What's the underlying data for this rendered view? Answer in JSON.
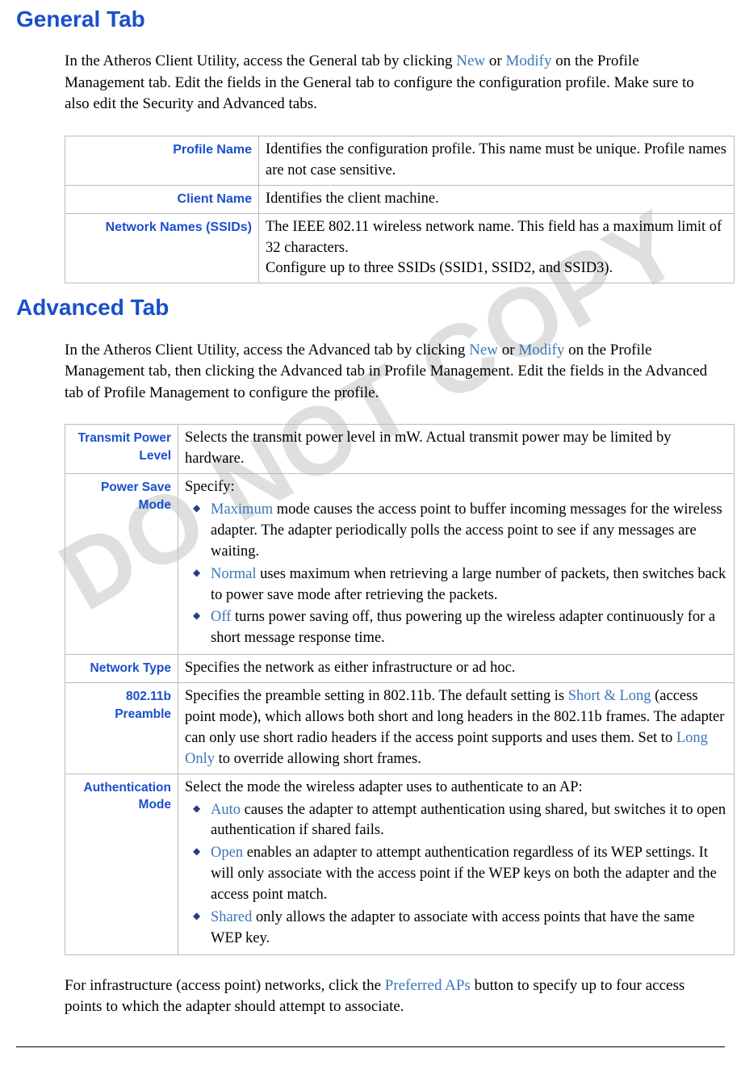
{
  "watermark": "DO NOT COPY",
  "general": {
    "heading": "General Tab",
    "intro_pre": "In the Atheros Client Utility, access the General tab by clicking ",
    "intro_new": "New",
    "intro_or": " or ",
    "intro_modify": "Modify",
    "intro_post": " on the Profile Management tab. Edit the fields in the General tab to configure the configuration profile. Make sure to also edit the Security and Advanced tabs.",
    "rows": {
      "profile_name": {
        "label": "Profile Name",
        "desc": "Identifies the configuration profile. This name must be unique. Profile names are not case sensitive."
      },
      "client_name": {
        "label": "Client Name",
        "desc": "Identifies the client machine."
      },
      "ssids": {
        "label": "Network Names (SSIDs)",
        "desc1": "The IEEE 802.11 wireless network name. This field has a maximum limit of 32 characters.",
        "desc2": "Configure up to three SSIDs (SSID1, SSID2, and SSID3)."
      }
    }
  },
  "advanced": {
    "heading": "Advanced Tab",
    "intro_pre": "In the Atheros Client Utility, access the Advanced tab by clicking ",
    "intro_new": "New",
    "intro_or": " or ",
    "intro_modify": "Modify",
    "intro_post": " on the Profile Management tab, then clicking the Advanced tab in Profile Management.  Edit the fields in the Advanced tab of Profile Management to configure the profile.",
    "rows": {
      "transmit": {
        "label": "Transmit Power Level",
        "desc": "Selects the transmit power level in mW. Actual transmit power may be limited by hardware."
      },
      "powersave": {
        "label": "Power Save Mode",
        "intro": "Specify:",
        "opts": {
          "max_name": "Maximum",
          "max_desc": " mode causes the  access point to buffer incoming messages for the wireless adapter.  The adapter periodically polls the access point to see if any messages are waiting.",
          "norm_name": "Normal",
          "norm_desc": " uses maximum when retrieving a large number of packets, then switches back to power save mode after retrieving the packets.",
          "off_name": "Off",
          "off_desc": " turns power saving off, thus powering up the wireless adapter continuously for a short message response time."
        }
      },
      "nettype": {
        "label": "Network Type",
        "desc": "Specifies the network as either infrastructure or ad hoc."
      },
      "preamble": {
        "label": "802.11b Preamble",
        "pre1": "Specifies the preamble setting in 802.11b.  The default setting is ",
        "short_long": "Short & Long",
        "mid": " (access point mode), which allows both short and long headers in the 802.11b frames.  The adapter can only use short radio headers if the access point supports and uses them. Set to ",
        "long_only": "Long Only",
        "post": " to override allowing short frames."
      },
      "auth": {
        "label": "Authentication Mode",
        "intro": "Select the mode the wireless adapter uses to authenticate to an AP:",
        "opts": {
          "auto_name": "Auto",
          "auto_desc": " causes the adapter to attempt authentication using shared, but switches it to open authentication if shared fails.",
          "open_name": "Open",
          "open_desc": " enables an adapter to attempt authentication regardless of its WEP settings. It will only associate with the access point if the WEP keys on both the adapter and the access point match.",
          "shared_name": "Shared",
          "shared_desc": " only allows the adapter to associate with access points that have the same WEP key."
        }
      }
    },
    "footer_pre": "For infrastructure (access point) networks, click the ",
    "footer_link": "Preferred APs",
    "footer_post": " button to specify up to four access points to which the  adapter should attempt to associate."
  }
}
